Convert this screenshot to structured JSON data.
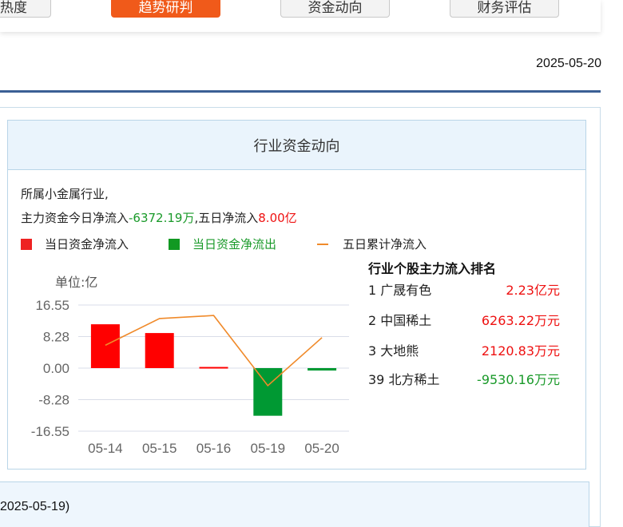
{
  "tabs": [
    {
      "label": "热度",
      "active": false
    },
    {
      "label": "趋势研判",
      "active": true
    },
    {
      "label": "资金动向",
      "active": false
    },
    {
      "label": "财务评估",
      "active": false
    }
  ],
  "report_date": "2025-05-20",
  "panel": {
    "title": "行业资金动向",
    "industry_line": "所属小金属行业,",
    "flow_prefix": "主力资金今日净流入",
    "today_value": "-6372.19",
    "today_unit": "万",
    "five_day_prefix": ",五日净流入",
    "five_day_value": "8.00",
    "five_day_unit": "亿"
  },
  "legend": {
    "inflow": "当日资金净流入",
    "outflow": "当日资金净流出",
    "cumulative": "五日累计净流入"
  },
  "chart_data": {
    "type": "bar",
    "unit_label": "单位:亿",
    "categories": [
      "05-14",
      "05-15",
      "05-16",
      "05-19",
      "05-20"
    ],
    "series": [
      {
        "name": "当日资金净流入",
        "color": "#ff0000",
        "values": [
          11.5,
          9.2,
          0.3,
          null,
          null
        ]
      },
      {
        "name": "当日资金净流出",
        "color": "#009933",
        "values": [
          null,
          null,
          null,
          -12.5,
          -0.64
        ]
      },
      {
        "name": "五日累计净流入",
        "type": "line",
        "color": "#f08a2a",
        "values": [
          6.0,
          13.0,
          13.8,
          -4.6,
          8.0
        ]
      }
    ],
    "yticks": [
      "16.55",
      "8.28",
      "0.00",
      "-8.28",
      "-16.55"
    ],
    "ylim": [
      -16.55,
      16.55
    ]
  },
  "ranking": {
    "title": "行业个股主力流入排名",
    "rows": [
      {
        "rank": "1",
        "name": "广晟有色",
        "value": "2.23",
        "unit": "亿元",
        "color": "#ee1111"
      },
      {
        "rank": "2",
        "name": "中国稀土",
        "value": "6263.22",
        "unit": "万元",
        "color": "#ee1111"
      },
      {
        "rank": "3",
        "name": "大地熊",
        "value": "2120.83",
        "unit": "万元",
        "color": "#ee1111"
      },
      {
        "rank": "39",
        "name": "北方稀土",
        "value": "-9530.16",
        "unit": "万元",
        "color": "#1a9a2a"
      }
    ]
  },
  "bottom_text": "2025-05-19)"
}
